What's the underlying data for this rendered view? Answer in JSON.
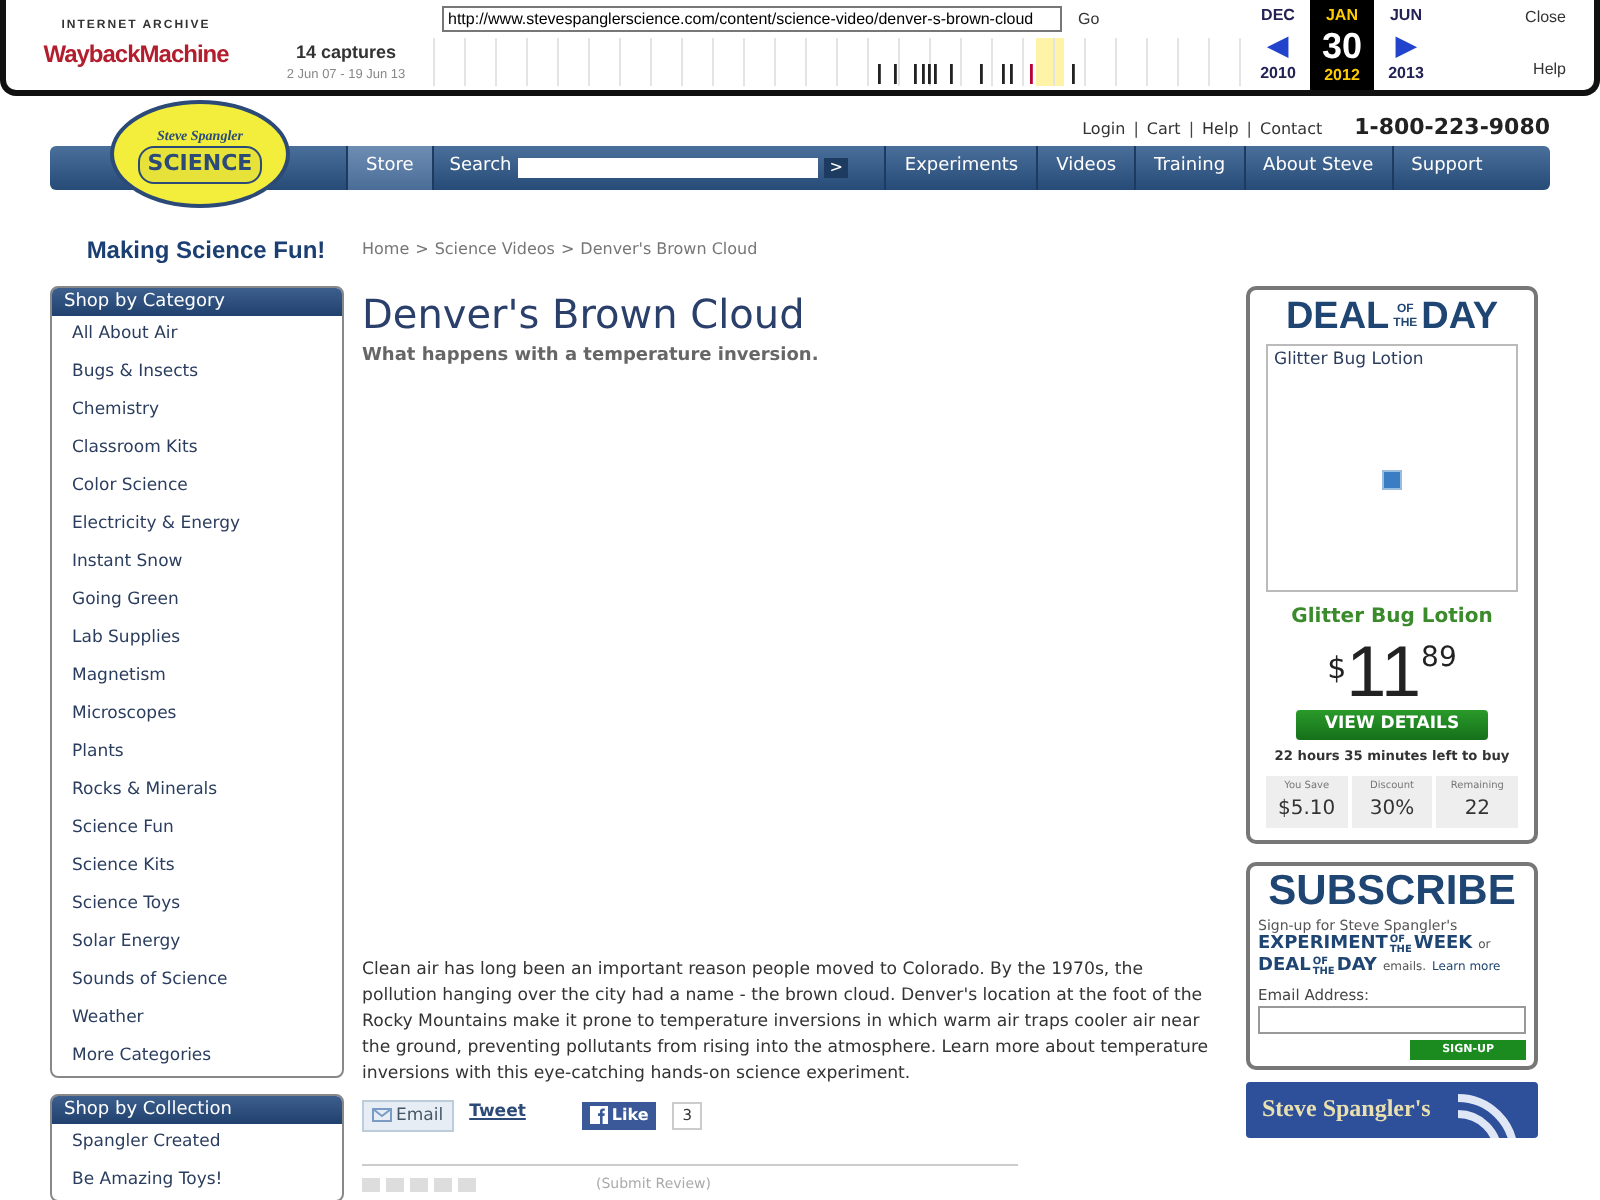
{
  "wayback": {
    "logo_top": "INTERNET ARCHIVE",
    "logo_main": "WaybackMachine",
    "url": "http://www.stevespanglerscience.com/content/science-video/denver-s-brown-cloud",
    "go": "Go",
    "captures": "14 captures",
    "range": "2 Jun 07 - 19 Jun 13",
    "prev": "◀",
    "next": "▶",
    "months": [
      {
        "month": "DEC",
        "year": "2010",
        "selected": false
      },
      {
        "month": "JAN",
        "day": "30",
        "year": "2012",
        "selected": true
      },
      {
        "month": "JUN",
        "year": "2013",
        "selected": false
      }
    ],
    "close": "Close",
    "help": "Help"
  },
  "header": {
    "logo_top": "Steve Spangler",
    "logo_main": "SCIENCE",
    "tagline": "Making Science Fun!",
    "top_links": [
      "Login",
      "Cart",
      "Help",
      "Contact"
    ],
    "link_separator": "|",
    "phone": "1-800-223-9080",
    "nav": [
      {
        "label": "Store",
        "kind": "link",
        "selected": true
      },
      {
        "label": "Search",
        "kind": "search",
        "selected": false
      },
      {
        "label": "Experiments",
        "kind": "link",
        "selected": false
      },
      {
        "label": "Videos",
        "kind": "link",
        "selected": false
      },
      {
        "label": "Training",
        "kind": "link",
        "selected": false
      },
      {
        "label": "About Steve",
        "kind": "link",
        "selected": false
      },
      {
        "label": "Support",
        "kind": "link",
        "selected": false
      }
    ],
    "search_go": ">"
  },
  "breadcrumb": [
    "Home",
    "Science Videos",
    "Denver's Brown Cloud"
  ],
  "breadcrumb_separator": ">",
  "sidebar": [
    {
      "title": "Shop by Category",
      "items": [
        "All About Air",
        "Bugs & Insects",
        "Chemistry",
        "Classroom Kits",
        "Color Science",
        "Electricity & Energy",
        "Instant Snow",
        "Going Green",
        "Lab Supplies",
        "Magnetism",
        "Microscopes",
        "Plants",
        "Rocks & Minerals",
        "Science Fun",
        "Science Kits",
        "Science Toys",
        "Solar Energy",
        "Sounds of Science",
        "Weather",
        "More Categories"
      ]
    },
    {
      "title": "Shop by Collection",
      "items": [
        "Spangler Created",
        "Be Amazing Toys!"
      ]
    }
  ],
  "article": {
    "title": "Denver's Brown Cloud",
    "subtitle": "What happens with a temperature inversion.",
    "body": "Clean air has long been an important reason people moved to Colorado. By the 1970s, the pollution hanging over the city had a name - the brown cloud. Denver's location at the foot of the Rocky Mountains make it prone to temperature inversions in which warm air traps cooler air near the ground, preventing pollutants from rising into the atmosphere. Learn more about temperature inversions with this eye-catching hands-on science experiment.",
    "email": "Email",
    "tweet": "Tweet",
    "like": "Like",
    "like_count": "3",
    "stars": 0,
    "review": "(Submit Review)"
  },
  "deal": {
    "title": [
      "DEAL",
      "OF",
      "THE",
      "DAY"
    ],
    "image_alt": "Glitter Bug Lotion",
    "product": "Glitter Bug Lotion",
    "currency": "$",
    "price": "11",
    "cents": "89",
    "button": "VIEW DETAILS",
    "time_left": "22 hours 35 minutes left to buy",
    "stats": [
      {
        "label": "You Save",
        "value": "$5.10"
      },
      {
        "label": "Discount",
        "value": "30%"
      },
      {
        "label": "Remaining",
        "value": "22"
      }
    ]
  },
  "subscribe": {
    "title": "SUBSCRIBE",
    "intro": "Sign-up for Steve Spangler's",
    "line1": [
      "EXPERIMENT",
      "OF",
      "THE",
      "WEEK"
    ],
    "or": "or",
    "line2": [
      "DEAL",
      "OF",
      "THE",
      "DAY"
    ],
    "emails": "emails.",
    "learn_more": "Learn more",
    "email_label": "Email Address:",
    "button": "SIGN-UP"
  },
  "blog": {
    "title": "Steve Spangler's"
  }
}
